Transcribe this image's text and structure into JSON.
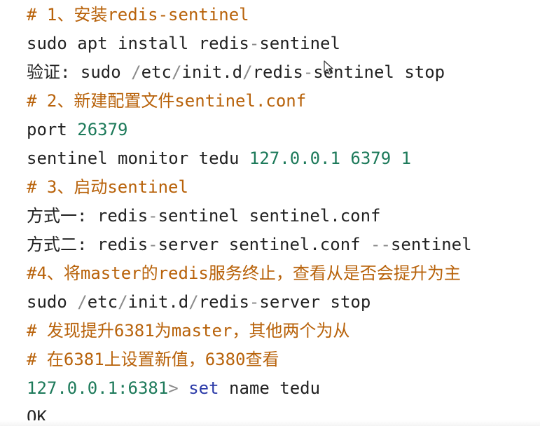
{
  "editor": {
    "colors": {
      "comment": "#b8620a",
      "text": "#222222",
      "number": "#1d7a5a",
      "operator": "#8a8a8a",
      "keyword": "#2b3aa8",
      "background": "#ffffff"
    },
    "cursor_icon": "mouse-pointer-icon",
    "lines": [
      {
        "segments": [
          {
            "style": "comment",
            "text": "# 1、安装redis-sentinel"
          }
        ]
      },
      {
        "segments": [
          {
            "style": "text",
            "text": "sudo apt install redis"
          },
          {
            "style": "operator",
            "text": "-"
          },
          {
            "style": "text",
            "text": "sentinel"
          }
        ]
      },
      {
        "segments": [
          {
            "style": "text",
            "text": "验证: sudo "
          },
          {
            "style": "operator",
            "text": "/"
          },
          {
            "style": "text",
            "text": "etc"
          },
          {
            "style": "operator",
            "text": "/"
          },
          {
            "style": "text",
            "text": "init.d"
          },
          {
            "style": "operator",
            "text": "/"
          },
          {
            "style": "text",
            "text": "redis"
          },
          {
            "style": "operator",
            "text": "-"
          },
          {
            "style": "text",
            "text": "sentinel stop"
          }
        ]
      },
      {
        "segments": [
          {
            "style": "comment",
            "text": "# 2、新建配置文件sentinel.conf"
          }
        ]
      },
      {
        "segments": [
          {
            "style": "text",
            "text": "port "
          },
          {
            "style": "number",
            "text": "26379"
          }
        ]
      },
      {
        "segments": [
          {
            "style": "text",
            "text": "sentinel monitor tedu "
          },
          {
            "style": "number",
            "text": "127.0.0.1 6379 1"
          }
        ]
      },
      {
        "segments": [
          {
            "style": "comment",
            "text": "# 3、启动sentinel"
          }
        ]
      },
      {
        "segments": [
          {
            "style": "text",
            "text": "方式一: redis"
          },
          {
            "style": "operator",
            "text": "-"
          },
          {
            "style": "text",
            "text": "sentinel sentinel.conf"
          }
        ]
      },
      {
        "segments": [
          {
            "style": "text",
            "text": "方式二: redis"
          },
          {
            "style": "operator",
            "text": "-"
          },
          {
            "style": "text",
            "text": "server sentinel.conf "
          },
          {
            "style": "operator",
            "text": "--"
          },
          {
            "style": "text",
            "text": "sentinel"
          }
        ]
      },
      {
        "segments": [
          {
            "style": "comment",
            "text": "#4、将master的redis服务终止，查看从是否会提升为主"
          }
        ]
      },
      {
        "segments": [
          {
            "style": "text",
            "text": "sudo "
          },
          {
            "style": "operator",
            "text": "/"
          },
          {
            "style": "text",
            "text": "etc"
          },
          {
            "style": "operator",
            "text": "/"
          },
          {
            "style": "text",
            "text": "init.d"
          },
          {
            "style": "operator",
            "text": "/"
          },
          {
            "style": "text",
            "text": "redis"
          },
          {
            "style": "operator",
            "text": "-"
          },
          {
            "style": "text",
            "text": "server stop"
          }
        ]
      },
      {
        "segments": [
          {
            "style": "comment",
            "text": "# 发现提升6381为master，其他两个为从"
          }
        ]
      },
      {
        "segments": [
          {
            "style": "comment",
            "text": "# 在6381上设置新值，6380查看"
          }
        ]
      },
      {
        "segments": [
          {
            "style": "number",
            "text": "127.0.0.1:6381"
          },
          {
            "style": "operator",
            "text": "> "
          },
          {
            "style": "keyword",
            "text": "set"
          },
          {
            "style": "text",
            "text": " name tedu"
          }
        ]
      },
      {
        "segments": [
          {
            "style": "text",
            "text": "OK"
          }
        ]
      }
    ]
  }
}
